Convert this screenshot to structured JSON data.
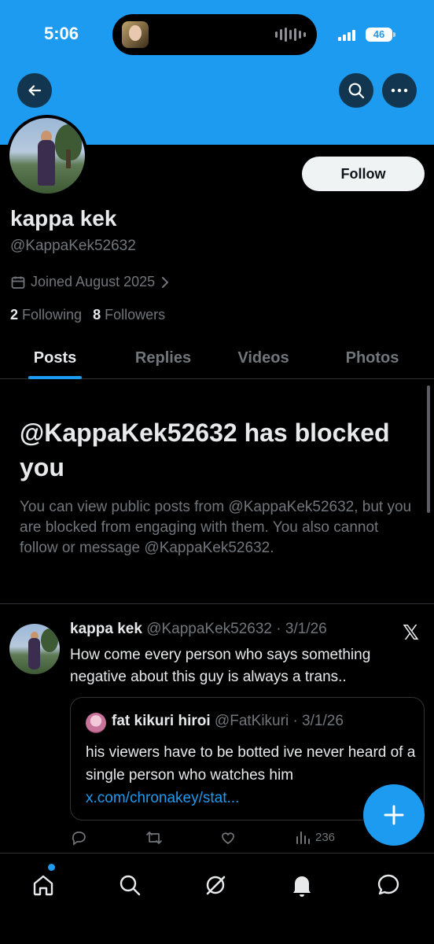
{
  "status_bar": {
    "time": "5:06",
    "battery": "46"
  },
  "header": {
    "back_icon": "arrow-left-icon",
    "search_icon": "search-icon",
    "more_icon": "more-horizontal-icon"
  },
  "profile": {
    "follow_label": "Follow",
    "display_name": "kappa kek",
    "handle": "@KappaKek52632",
    "joined": "Joined August 2025",
    "following_count": "2",
    "following_label": "Following",
    "followers_count": "8",
    "followers_label": "Followers"
  },
  "tabs": [
    {
      "label": "Posts",
      "active": true
    },
    {
      "label": "Replies",
      "active": false
    },
    {
      "label": "Videos",
      "active": false
    },
    {
      "label": "Photos",
      "active": false
    }
  ],
  "blocked_notice": {
    "title": "@KappaKek52632 has blocked you",
    "body": "You can view public posts from @KappaKek52632, but you are blocked from engaging with them. You also cannot follow or message @KappaKek52632."
  },
  "tweet": {
    "name": "kappa kek",
    "meta": "@KappaKek52632 · 3/1/26",
    "text": "How come every person who says something negative about this guy is always a trans..",
    "quote": {
      "name": "fat kikuri hiroi",
      "meta": "@FatKikuri · 3/1/26",
      "text": "his viewers have to be botted ive never heard of a single person who watches him",
      "link": "x.com/chronakey/stat..."
    },
    "views": "236"
  },
  "colors": {
    "accent": "#1d9bf0",
    "background": "#000000",
    "text_primary": "#e7e9ea",
    "text_secondary": "#71767b",
    "border": "#2f3336"
  },
  "bottom_nav": [
    "home-icon",
    "search-icon",
    "grok-icon",
    "notifications-icon",
    "messages-icon"
  ]
}
